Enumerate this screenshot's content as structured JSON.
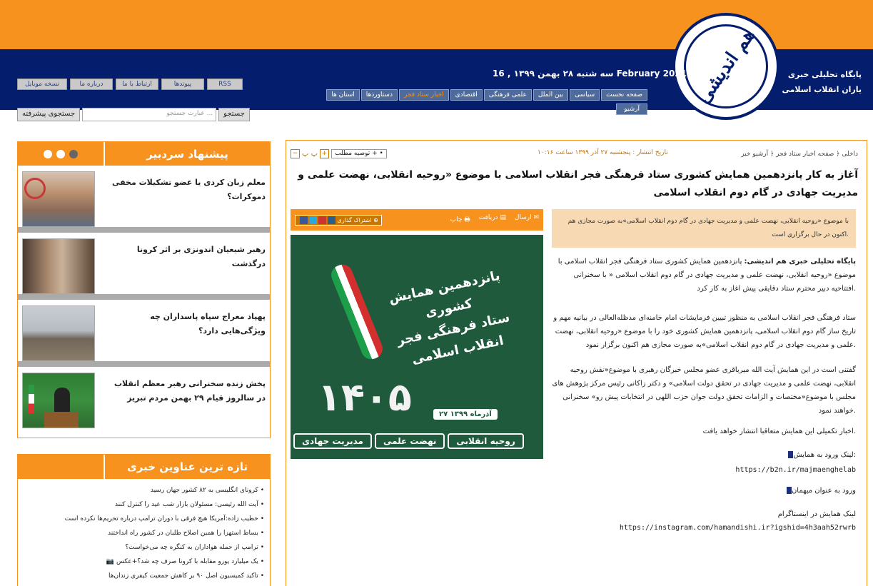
{
  "header": {
    "tagline": "پایگاه تحلیلی خبری یاران انقلاب اسلامی",
    "logo_text": "هم اندیشی",
    "date": "سه شنبه ۲۸ بهمن ۱۳۹۹ , 16 February 2021",
    "nav": [
      "صفحه نخست",
      "سیاسی",
      "بین الملل",
      "علمی فرهنگی",
      "اقتصادی",
      "اخبار ستاد فجر",
      "دستاوردها",
      "استان ها"
    ],
    "nav_archive": "آرشیو",
    "top_buttons": [
      "نسخه موبایل",
      "درباره ما",
      "ارتباط با ما",
      "پیوندها",
      "RSS"
    ],
    "search_btn": "جستجو",
    "search_placeholder": "عبارت جستجو ...",
    "advanced_btn": "جستجوی پیشرفته"
  },
  "sidebar": {
    "suggest_title": "پیشنهاد سردبیر",
    "suggest": [
      "معلم زبان کردی یا عضو تشکیلات مخفی دموکرات؟",
      "رهبر شیعیان اندونزی بر اثر کرونا درگذشت",
      "پهپاد معراج سپاه پاسداران چه ویژگی‌هایی دارد؟",
      "پخش زنده سخنرانی رهبر معظم انقلاب در سالروز قیام ۲۹ بهمن مردم تبریز"
    ],
    "latest_title": "تازه ترین عناوین خبری",
    "latest": [
      "کرونای انگلیسی به ۸۲ کشور جهان رسید",
      "آیت الله رئیسی: مسئولان بازار شب عید را کنترل کنند",
      "خطیب زاده:آمریکا هیچ فرقی با دوران ترامپ درباره تحریم‌ها نکرده است",
      "بساط استهزا را همین اصلاح طلبان در کشور راه انداختند",
      "ترامپ از حمله هواداران به کنگره چه می‌خواست؟",
      "یک میلیارد یورو مقابله با کرونا صرف چه شد؟+عکس",
      "تاکید کمیسیون اصل ۹۰ بر کاهش جمعیت کیفری زندان‌ها"
    ]
  },
  "article": {
    "breadcrumb": "داخلی ﴿ صفحه اخبار ستاد فجر ﴿ آرشیو خبر",
    "pubdate": "تاریخ انتشار : پنجشنبه ۲۷ آذر ۱۳۹۹ ساعت ۱۰:۱۶",
    "recommend": "توصیه مطلب",
    "headline": "آغاز به کار پانزدهمین همایش کشوری ستاد فرهنگی فجر انقلاب اسلامی با موضوع «روحیه انقلابی، نهضت علمی و مدیریت جهادی در گام دوم انقلاب اسلامی",
    "tools": {
      "send": "ارسال",
      "download": "دریافت",
      "print": "چاپ",
      "share": "اشتراک گذاری"
    },
    "lead": "با موضوع «روحیه انقلابی، نهضت علمی و مدیریت جهادی در گام دوم انقلاب اسلامی»به صورت مجازی هم اکنون در حال برگزاری است.",
    "p1_bold": "پایگاه تحلیلی خبری هم اندیشی:",
    "p1": " پانزدهمین همایش کشوری ستاد فرهنگی فجر انقلاب اسلامی با موضوع «روحیه انقلابی، نهضت علمی و مدیریت جهادی در گام دوم انقلاب اسلامی « با سخنرانی افتتاحیه دبیر محترم ستاد دقایقی پیش اغاز به کار کرد.",
    "p2": "ستاد فرهنگی فجر انقلاب اسلامی به منظور تبیین فرمایشات امام خامنه‌ای مدظله‌العالی در بیانیه مهم و تاریخ ساز گام دوم انقلاب اسلامی، پانزدهمین همایش کشوری خود را با موضوع «روحیه انقلابی، نهضت علمی و مدیریت جهادی در گام دوم انقلاب اسلامی»به صورت مجازی هم اکنون برگزار نمود.",
    "p3": "گفتنی است در این همایش آیت الله میرباقری عضو مجلس خبرگان رهبری با موضوع«نقش روحیه انقلابی، نهضت علمی و مدیریت جهادی در تحقق دولت اسلامی» و دکتر زاکانی رئیس مرکز پژوهش های مجلس با موضوع«مختصات و الزامات تحقق دولت جوان حزب اللهی در انتخابات پیش رو» سخنرانی خواهند نمود.",
    "p4": "اخبار تکمیلی این همایش متعاقبا انتشار خواهد یافت.",
    "link1_label": "لینک ورود به همایش:",
    "link1": "https://b2n.ir/majmaenghelab",
    "link2_label": "ورود به عنوان میهمان",
    "link3_label": "لینک همایش در اینستاگرام",
    "link3": "https://instagram.com/hamandishi.ir?igshid=4h3aah52rwrb",
    "poster": {
      "title1": "پانزدهمین همایش کشوری",
      "title2": "ستاد فرهنگی فجر انقلاب اسلامی",
      "date": "۲۷ آذرماه ۱۳۹۹",
      "tags": [
        "روحیه انقلابی",
        "نهضت علمی",
        "مدیریت جهادی"
      ]
    }
  }
}
